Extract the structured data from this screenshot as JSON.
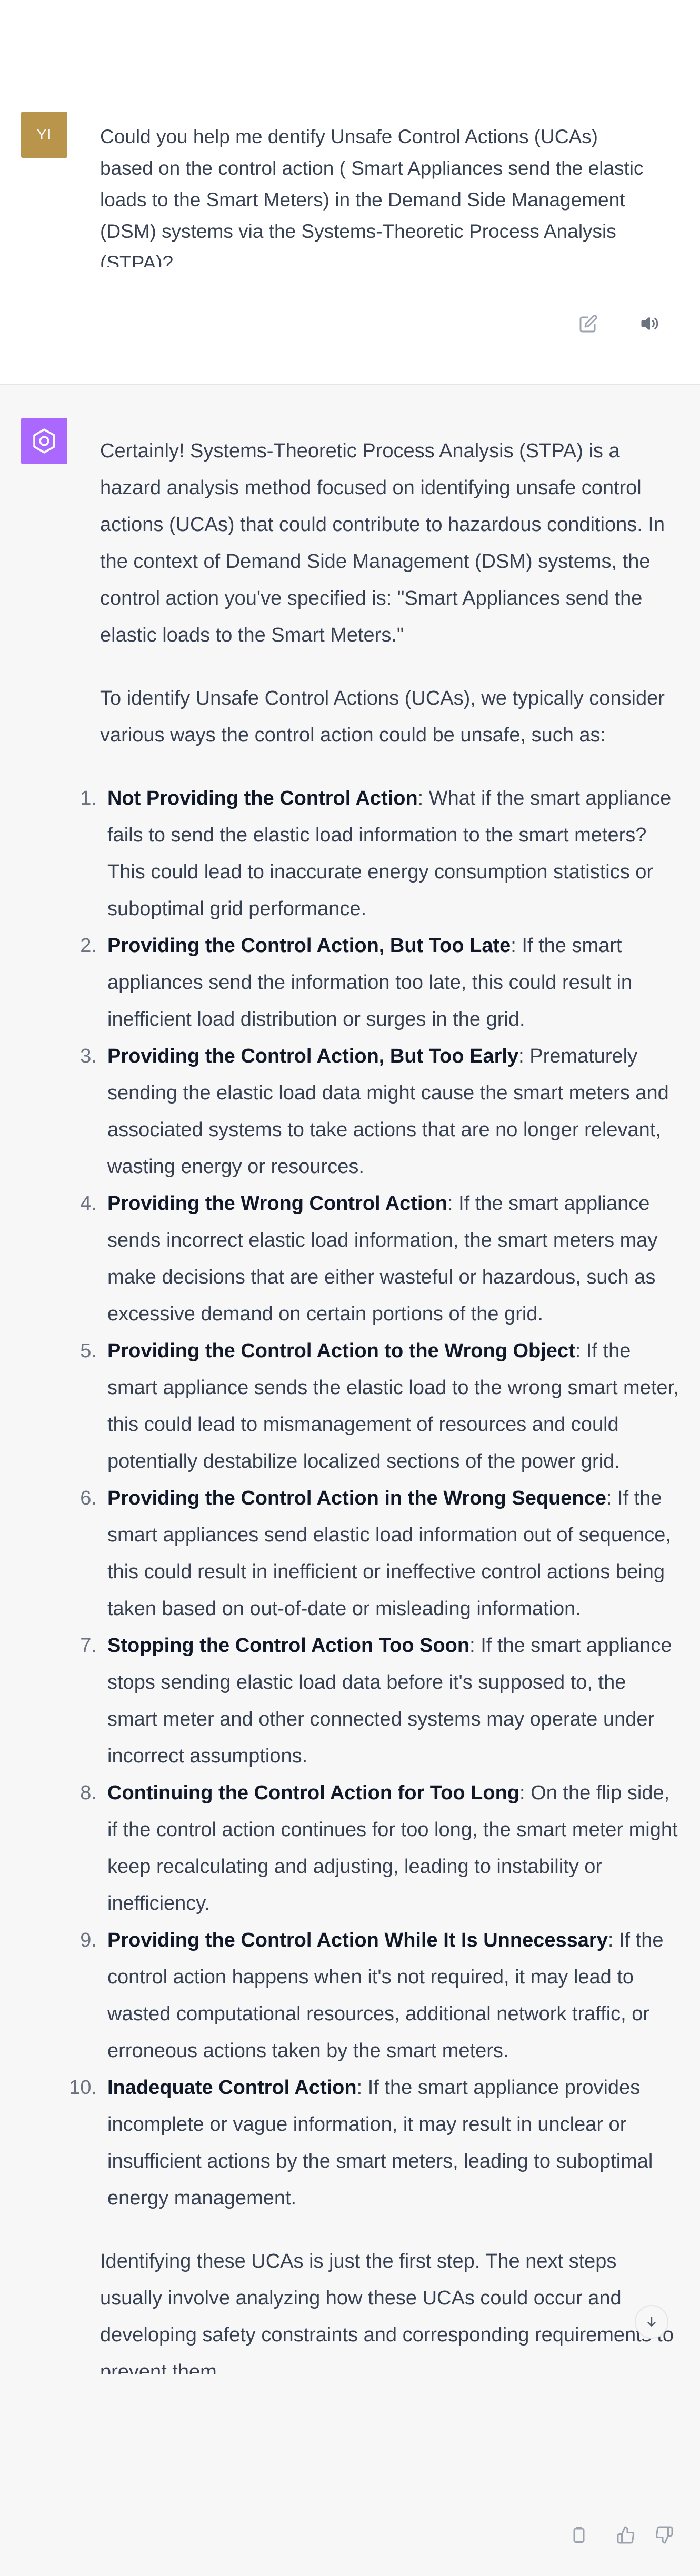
{
  "user": {
    "avatar_initials": "YI",
    "message": "Could you help me dentify Unsafe Control Actions (UCAs) based on the control action ( Smart Appliances send the elastic loads to the Smart Meters) in the Demand Side Management (DSM) systems via the Systems-Theoretic Process Analysis (STPA)?",
    "actions": [
      {
        "name": "edit-icon"
      },
      {
        "name": "speaker-icon"
      }
    ]
  },
  "assistant": {
    "avatar_icon": "openai-logo-icon",
    "intro": "Certainly! Systems-Theoretic Process Analysis (STPA) is a hazard analysis method focused on identifying unsafe control actions (UCAs) that could contribute to hazardous conditions. In the context of Demand Side Management (DSM) systems, the control action you've specified is: \"Smart Appliances send the elastic loads to the Smart Meters.\"",
    "lead_in": "To identify Unsafe Control Actions (UCAs), we typically consider various ways the control action could be unsafe, such as:",
    "items": [
      {
        "num": "1.",
        "title": "Not Providing the Control Action",
        "text": ": What if the smart appliance fails to send the elastic load information to the smart meters? This could lead to inaccurate energy consumption statistics or suboptimal grid performance."
      },
      {
        "num": "2.",
        "title": "Providing the Control Action, But Too Late",
        "text": ": If the smart appliances send the information too late, this could result in inefficient load distribution or surges in the grid."
      },
      {
        "num": "3.",
        "title": "Providing the Control Action, But Too Early",
        "text": ": Prematurely sending the elastic load data might cause the smart meters and associated systems to take actions that are no longer relevant, wasting energy or resources."
      },
      {
        "num": "4.",
        "title": "Providing the Wrong Control Action",
        "text": ": If the smart appliance sends incorrect elastic load information, the smart meters may make decisions that are either wasteful or hazardous, such as excessive demand on certain portions of the grid."
      },
      {
        "num": "5.",
        "title": "Providing the Control Action to the Wrong Object",
        "text": ": If the smart appliance sends the elastic load to the wrong smart meter, this could lead to mismanagement of resources and could potentially destabilize localized sections of the power grid."
      },
      {
        "num": "6.",
        "title": "Providing the Control Action in the Wrong Sequence",
        "text": ": If the smart appliances send elastic load information out of sequence, this could result in inefficient or ineffective control actions being taken based on out-of-date or misleading information."
      },
      {
        "num": "7.",
        "title": "Stopping the Control Action Too Soon",
        "text": ": If the smart appliance stops sending elastic load data before it's supposed to, the smart meter and other connected systems may operate under incorrect assumptions."
      },
      {
        "num": "8.",
        "title": "Continuing the Control Action for Too Long",
        "text": ": On the flip side, if the control action continues for too long, the smart meter might keep recalculating and adjusting, leading to instability or inefficiency."
      },
      {
        "num": "9.",
        "title": "Providing the Control Action While It Is Unnecessary",
        "text": ": If the control action happens when it's not required, it may lead to wasted computational resources, additional network traffic, or erroneous actions taken by the smart meters."
      },
      {
        "num": "10.",
        "title": "Inadequate Control Action",
        "text": ": If the smart appliance provides incomplete or vague information, it may result in unclear or insufficient actions by the smart meters, leading to suboptimal energy management."
      }
    ],
    "outro": "Identifying these UCAs is just the first step. The next steps usually involve analyzing how these UCAs could occur and developing safety constraints and corresponding requirements to prevent them.",
    "scroll_button_icon": "arrow-down-icon",
    "actions": [
      {
        "name": "copy-icon"
      },
      {
        "name": "thumbs-up-icon"
      },
      {
        "name": "thumbs-down-icon"
      }
    ]
  },
  "colors": {
    "user_avatar_bg": "#b8954a",
    "assistant_avatar_bg": "#ab68ff",
    "page_bg": "#f7f7f8",
    "user_bg": "#ffffff",
    "text": "#374151"
  }
}
